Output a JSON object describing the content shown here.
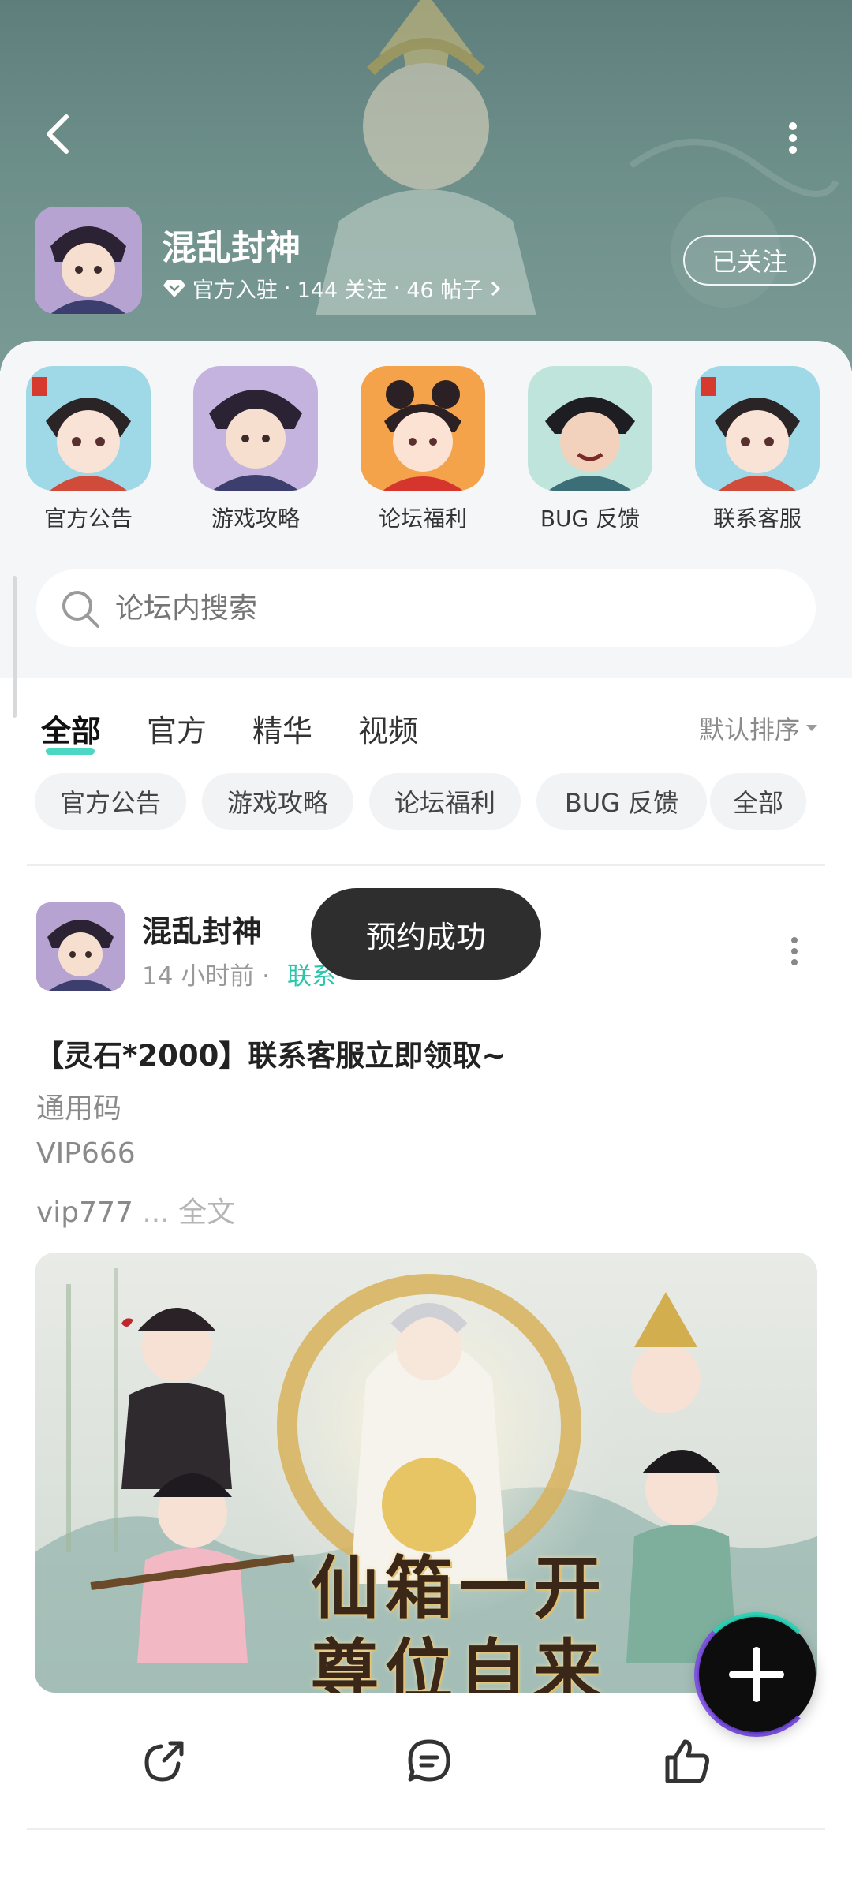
{
  "header": {
    "app_name": "混乱封神",
    "verified_label": "官方入驻",
    "followers": "144 关注",
    "posts": "46 帖子",
    "separator": "·",
    "follow_button": "已关注"
  },
  "quick_links": [
    {
      "label": "官方公告",
      "icon": "announcement-avatar"
    },
    {
      "label": "游戏攻略",
      "icon": "guide-avatar"
    },
    {
      "label": "论坛福利",
      "icon": "benefits-avatar"
    },
    {
      "label": "BUG 反馈",
      "icon": "bug-report-avatar"
    },
    {
      "label": "联系客服",
      "icon": "customer-service-avatar"
    }
  ],
  "search": {
    "placeholder": "论坛内搜索"
  },
  "tabs": [
    {
      "label": "全部",
      "active": true
    },
    {
      "label": "官方"
    },
    {
      "label": "精华"
    },
    {
      "label": "视频"
    }
  ],
  "sort_label": "默认排序",
  "chips": [
    "官方公告",
    "游戏攻略",
    "论坛福利",
    "BUG 反馈",
    "全部"
  ],
  "post": {
    "author": "混乱封神",
    "time": "14 小时前",
    "dot": "·",
    "channel": "联系",
    "title": "【灵石*2000】联系客服立即领取~",
    "lines": [
      "通用码",
      "VIP666",
      "vip777"
    ],
    "ellipsis": " ... ",
    "full_text": "全文",
    "banner_line1": "仙箱一开",
    "banner_line2": "尊位自来"
  },
  "toast": "预约成功",
  "colors": {
    "accent": "#2bd0b7",
    "header_bg": "#6d8f8a",
    "toast_bg": "#2e2e2e"
  }
}
